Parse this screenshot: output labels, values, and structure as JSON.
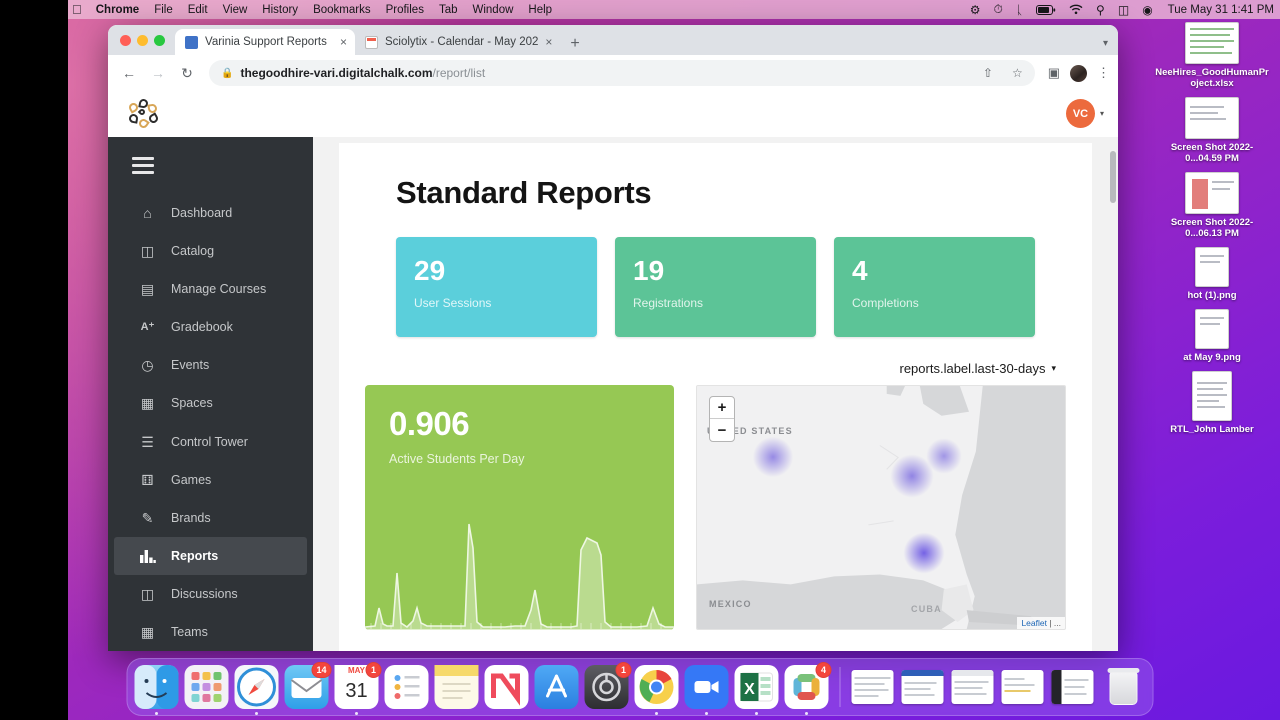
{
  "menubar": {
    "apple_glyph": "",
    "items": [
      "Chrome",
      "File",
      "Edit",
      "View",
      "History",
      "Bookmarks",
      "Profiles",
      "Tab",
      "Window",
      "Help"
    ],
    "status_icons": [
      "gear-icon",
      "timer-icon",
      "bluetooth-icon",
      "battery-icon",
      "wifi-icon",
      "search-icon",
      "airplay-icon",
      "siri-icon"
    ],
    "clock": "Tue May 31  1:41 PM"
  },
  "desktop_icons": [
    {
      "label": "NeeHires_GoodHumanProject.xlsx",
      "type": "spreadsheet"
    },
    {
      "label": "Screen Shot 2022-0...04.59 PM",
      "type": "screenshot"
    },
    {
      "label": "Screen Shot 2022-0...06.13 PM",
      "type": "screenshot"
    },
    {
      "label": "hot (1).png",
      "type": "screenshot"
    },
    {
      "label": "at May 9.png",
      "type": "screenshot"
    },
    {
      "label": "RTL_John Lamber",
      "type": "document"
    }
  ],
  "browser": {
    "tabs": [
      {
        "title": "Varinia Support Reports",
        "favicon": "report-favicon",
        "active": true,
        "close_label": "×"
      },
      {
        "title": "Sciolytix - Calendar - May 202",
        "favicon": "calendar-favicon",
        "active": false,
        "close_label": "×"
      }
    ],
    "new_tab_label": "+",
    "nav": {
      "back": "←",
      "forward": "→",
      "reload": "↻"
    },
    "omnibox": {
      "lock_icon": "lock-icon",
      "host": "thegoodhire-vari.digitalchalk.com",
      "path": "/report/list",
      "share_icon": "share-icon",
      "bookmark_icon": "star-icon"
    },
    "toolbar_right": {
      "sidepanel_icon": "side-panel-icon",
      "profile_icon": "profile-avatar",
      "menu_icon": "three-dot-menu-icon"
    }
  },
  "app": {
    "logo_name": "varinia-logo",
    "user_initials": "VC",
    "user_caret": "▾"
  },
  "sidebar": {
    "menu_toggle": "hamburger-menu",
    "items": [
      {
        "label": "Dashboard",
        "icon": "⌂",
        "name": "dashboard",
        "active": false
      },
      {
        "label": "Catalog",
        "icon": "◫",
        "name": "catalog",
        "active": false
      },
      {
        "label": "Manage Courses",
        "icon": "▶",
        "name": "manage-courses",
        "active": false
      },
      {
        "label": "Gradebook",
        "icon": "A⁺",
        "name": "gradebook",
        "active": false
      },
      {
        "label": "Events",
        "icon": "◷",
        "name": "events",
        "active": false
      },
      {
        "label": "Spaces",
        "icon": "░",
        "name": "spaces",
        "active": false
      },
      {
        "label": "Control Tower",
        "icon": "☲",
        "name": "control-tower",
        "active": false
      },
      {
        "label": "Games",
        "icon": "⚅",
        "name": "games",
        "active": false
      },
      {
        "label": "Brands",
        "icon": "✎",
        "name": "brands",
        "active": false
      },
      {
        "label": "Reports",
        "icon": "█",
        "name": "reports",
        "active": true
      },
      {
        "label": "Discussions",
        "icon": "▣",
        "name": "discussions",
        "active": false
      },
      {
        "label": "Teams",
        "icon": "▞",
        "name": "teams",
        "active": false
      }
    ]
  },
  "main": {
    "title": "Standard Reports",
    "stats": [
      {
        "value": "29",
        "label": "User Sessions",
        "color": "#5bcfdb"
      },
      {
        "value": "19",
        "label": "Registrations",
        "color": "#5cc497"
      },
      {
        "value": "4",
        "label": "Completions",
        "color": "#5cc497"
      }
    ],
    "range_selector": {
      "label": "reports.label.last-30-days",
      "caret": "▾"
    },
    "active_students": {
      "value": "0.906",
      "label": "Active Students Per Day",
      "color": "#96c854"
    },
    "map": {
      "zoom_in": "+",
      "zoom_out": "−",
      "labels": [
        "UNITED STATES",
        "MEXICO",
        "CUBA"
      ],
      "attribution": "Leaflet",
      "attribution_sep": " | ...",
      "heat_color": "#6d5ae0"
    }
  },
  "chart_data": {
    "type": "area",
    "title": "Active Students Per Day",
    "value_label": "0.906",
    "xlabel": "",
    "ylabel": "Active Students",
    "ylim": [
      0,
      1
    ],
    "x": [
      0,
      1,
      2,
      3,
      4,
      5,
      6,
      7,
      8,
      9,
      10,
      11,
      12,
      13,
      14,
      15,
      16,
      17,
      18,
      19,
      20,
      21,
      22,
      23,
      24,
      25,
      26,
      27,
      28,
      29
    ],
    "values": [
      0.02,
      0.05,
      0.3,
      0.06,
      0.55,
      0.08,
      0.02,
      0.18,
      0.04,
      0.02,
      0.03,
      0.95,
      0.1,
      0.02,
      0.02,
      0.03,
      0.04,
      0.03,
      0.28,
      0.05,
      0.02,
      0.02,
      0.8,
      0.86,
      0.82,
      0.04,
      0.02,
      0.02,
      0.2,
      0.03
    ],
    "grid": false,
    "legend": "none"
  },
  "dock": {
    "apps": [
      {
        "name": "finder",
        "badge": null
      },
      {
        "name": "launchpad",
        "badge": null
      },
      {
        "name": "safari",
        "badge": null
      },
      {
        "name": "mail",
        "badge": "14"
      },
      {
        "name": "calendar",
        "badge": "1",
        "month": "MAY",
        "day": "31"
      },
      {
        "name": "reminders",
        "badge": null
      },
      {
        "name": "notes",
        "badge": null
      },
      {
        "name": "news",
        "badge": null
      },
      {
        "name": "app-store",
        "badge": null
      },
      {
        "name": "system-prefs",
        "badge": "1"
      },
      {
        "name": "chrome",
        "badge": null
      },
      {
        "name": "zoom",
        "badge": null
      },
      {
        "name": "excel",
        "badge": null
      },
      {
        "name": "slack",
        "badge": "4"
      }
    ],
    "minimized_windows": [
      "window-1",
      "window-2",
      "window-3",
      "window-4",
      "window-5"
    ],
    "trash": "trash-icon"
  }
}
